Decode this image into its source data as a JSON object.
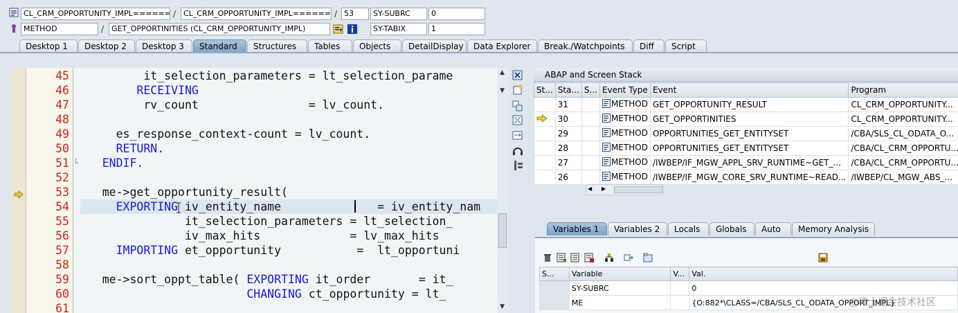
{
  "header": {
    "program_field": "CL_CRM_OPPORTUNITY_IMPL======...",
    "include_field": "CL_CRM_OPPORTUNITY_IMPL======...",
    "line_number": "53",
    "var1_name": "SY-SUBRC",
    "var1_value": "0",
    "event_type": "METHOD",
    "event_name": "GET_OPPORTINITIES (CL_CRM_OPPORTUNITY_IMPL)",
    "var2_name": "SY-TABIX",
    "var2_value": "1",
    "slash": "/"
  },
  "tabs": [
    "Desktop 1",
    "Desktop 2",
    "Desktop 3",
    "Standard",
    "Structures",
    "Tables",
    "Objects",
    "DetailDisplay",
    "Data Explorer",
    "Break./Watchpoints",
    "Diff",
    "Script"
  ],
  "active_tab": "Standard",
  "editor": {
    "lines": [
      {
        "num": "45",
        "code": [
          {
            "t": "          it_selection_parameters = lt_selection_parame",
            "k": false
          }
        ]
      },
      {
        "num": "46",
        "code": [
          {
            "t": "         ",
            "k": false
          },
          {
            "t": "RECEIVING",
            "k": true
          }
        ]
      },
      {
        "num": "47",
        "code": [
          {
            "t": "          rv_count                = lv_count.",
            "k": false
          }
        ]
      },
      {
        "num": "48",
        "code": [
          {
            "t": "",
            "k": false
          }
        ]
      },
      {
        "num": "49",
        "code": [
          {
            "t": "      es_response_context-count = lv_count.",
            "k": false
          }
        ]
      },
      {
        "num": "50",
        "code": [
          {
            "t": "      ",
            "k": false
          },
          {
            "t": "RETURN.",
            "k": true
          }
        ]
      },
      {
        "num": "51",
        "code": [
          {
            "t": "    ",
            "k": false
          },
          {
            "t": "ENDIF.",
            "k": true
          }
        ]
      },
      {
        "num": "52",
        "code": [
          {
            "t": "",
            "k": false
          }
        ]
      },
      {
        "num": "53",
        "code": [
          {
            "t": "    me->get_opportunity_result(",
            "k": false
          }
        ]
      },
      {
        "num": "54",
        "code": [
          {
            "t": "      ",
            "k": false
          },
          {
            "t": "EXPORTING",
            "k": true
          },
          {
            "t": " iv_entity_name              = iv_entity_nam",
            "k": false
          }
        ]
      },
      {
        "num": "55",
        "code": [
          {
            "t": "                it_selection_parameters = lt_selection_",
            "k": false
          }
        ]
      },
      {
        "num": "56",
        "code": [
          {
            "t": "                iv_max_hits             = lv_max_hits",
            "k": false
          }
        ]
      },
      {
        "num": "57",
        "code": [
          {
            "t": "      ",
            "k": false
          },
          {
            "t": "IMPORTING",
            "k": true
          },
          {
            "t": " et_opportunity           =  lt_opportuni",
            "k": false
          }
        ]
      },
      {
        "num": "58",
        "code": [
          {
            "t": "",
            "k": false
          }
        ]
      },
      {
        "num": "59",
        "code": [
          {
            "t": "    me->sort_oppt_table( ",
            "k": false
          },
          {
            "t": "EXPORTING",
            "k": true
          },
          {
            "t": " it_order       = it_",
            "k": false
          }
        ]
      },
      {
        "num": "60",
        "code": [
          {
            "t": "                         ",
            "k": false
          },
          {
            "t": "CHANGING",
            "k": true
          },
          {
            "t": " ct_opportunity = lt_",
            "k": false
          }
        ]
      },
      {
        "num": "61",
        "code": [
          {
            "t": "",
            "k": false
          }
        ]
      }
    ],
    "current_line": "53",
    "highlight_line": "54"
  },
  "stack": {
    "title": "ABAP and Screen Stack",
    "columns": [
      "St...",
      "Sta...",
      "S...",
      "Event Type",
      "Event",
      "Program"
    ],
    "rows": [
      {
        "level": "31",
        "type": "METHOD",
        "event": "GET_OPPORTUNITY_RESULT",
        "program": "CL_CRM_OPPORTUNITY...",
        "current": false
      },
      {
        "level": "30",
        "type": "METHOD",
        "event": "GET_OPPORTINITIES",
        "program": "CL_CRM_OPPORTUNITY...",
        "current": true
      },
      {
        "level": "29",
        "type": "METHOD",
        "event": "OPPORTUNITIES_GET_ENTITYSET",
        "program": "/CBA/SLS_CL_ODATA_O...",
        "current": false
      },
      {
        "level": "28",
        "type": "METHOD",
        "event": "OPPORTUNITIES_GET_ENTITYSET",
        "program": "/CBA/CL_CRM_OPPORTU...",
        "current": false
      },
      {
        "level": "27",
        "type": "METHOD",
        "event": "/IWBEP/IF_MGW_APPL_SRV_RUNTIME~GET_...",
        "program": "/CBA/CL_CRM_OPPORTU...",
        "current": false
      },
      {
        "level": "26",
        "type": "METHOD",
        "event": "/IWBEP/IF_MGW_CORE_SRV_RUNTIME~READ...",
        "program": "/IWBEP/CL_MGW_ABS_...",
        "current": false
      }
    ]
  },
  "var_tabs": [
    "Variables 1",
    "Variables 2",
    "Locals",
    "Globals",
    "Auto",
    "Memory Analysis"
  ],
  "active_var_tab": "Variables 1",
  "variables": {
    "columns": [
      "S...",
      "Variable",
      "V...",
      "Val."
    ],
    "rows": [
      {
        "name": "SY-SUBRC",
        "value": "0"
      },
      {
        "name": "ME",
        "value": "{O:882*\\CLASS=/CBA/SLS_CL_ODATA_OPPORT_IMPL}"
      }
    ]
  },
  "watermark": "@稀土掘金技术社区",
  "colors": {
    "keyword": "#1919d6",
    "line_number": "#d11f1f",
    "active_tab": "#8fb0d2"
  }
}
